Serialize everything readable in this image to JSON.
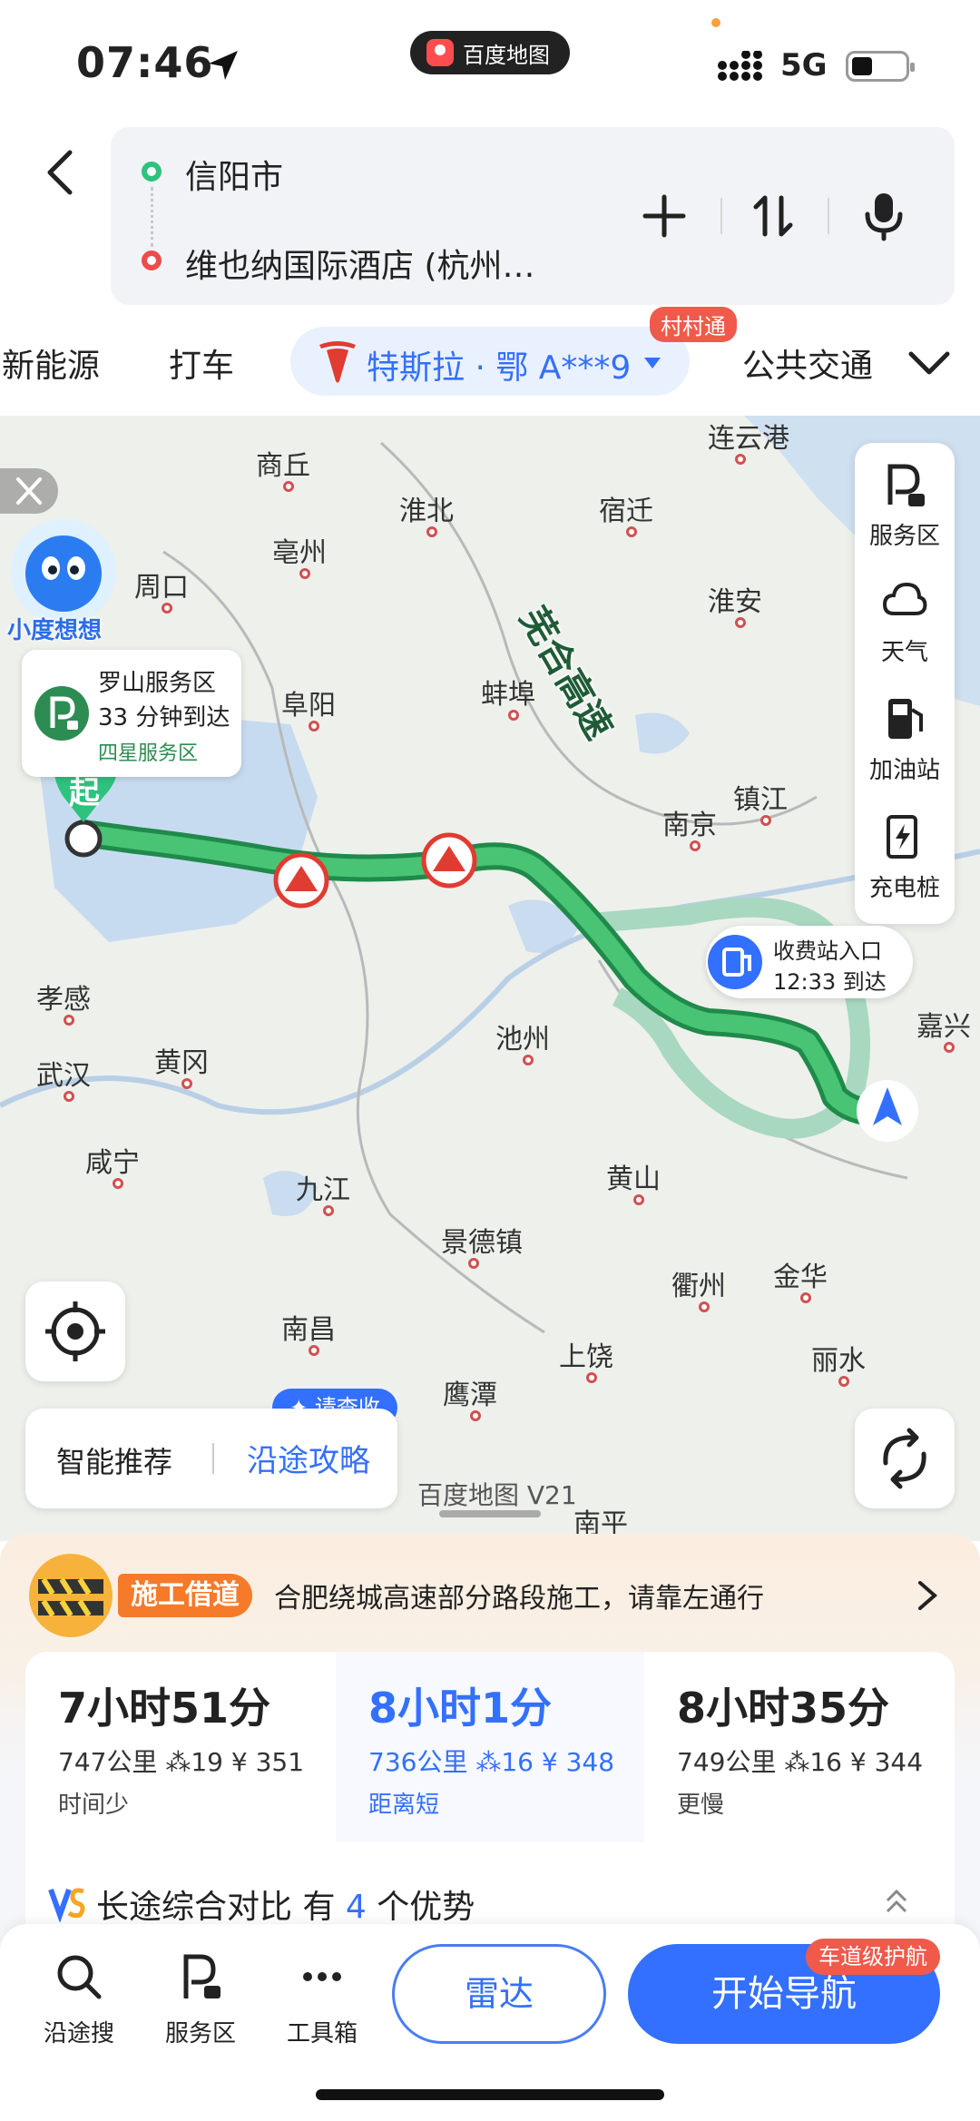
{
  "status_bar": {
    "time": "07:46",
    "app_name": "百度地图",
    "network": "5G"
  },
  "route": {
    "origin": "信阳市",
    "destination": "维也纳国际酒店 (杭州…"
  },
  "modes": {
    "new_energy": "新能源",
    "taxi": "打车",
    "car": "特斯拉 · 鄂 A***9",
    "car_badge": "村村通",
    "transit": "公共交通"
  },
  "map": {
    "cities": [
      "连云港",
      "商丘",
      "淮北",
      "宿迁",
      "亳州",
      "周口",
      "淮安",
      "阜阳",
      "蚌埠",
      "镇江",
      "南京",
      "孝感",
      "池州",
      "嘉兴",
      "武汉",
      "黄冈",
      "咸宁",
      "九江",
      "黄山",
      "景德镇",
      "衢州",
      "金华",
      "南昌",
      "上饶",
      "丽水",
      "鹰潭",
      "南平"
    ],
    "assistant": "小度想想",
    "service_area": {
      "name": "罗山服务区",
      "eta": "33 分钟到达",
      "level": "四星服务区"
    },
    "start_label": "起",
    "highway_label": "芜合高速",
    "toll": {
      "name": "收费站入口",
      "eta": "12:33 到达"
    },
    "side_tools": [
      "服务区",
      "天气",
      "加油站",
      "充电桩"
    ],
    "smart_recommend": "智能推荐",
    "along_guide": "沿途攻略",
    "check_badge": "✦ 请查收",
    "brand": "百度地图 V21"
  },
  "notice": {
    "tag": "施工借道",
    "message": "合肥绕城高速部分路段施工，请靠左通行"
  },
  "route_options": [
    {
      "duration": "7小时51分",
      "distance": "747公里",
      "lights": "19",
      "cost": "¥ 351",
      "tag": "时间少"
    },
    {
      "duration": "8小时1分",
      "distance": "736公里",
      "lights": "16",
      "cost": "¥ 348",
      "tag": "距离短"
    },
    {
      "duration": "8小时35分",
      "distance": "749公里",
      "lights": "16",
      "cost": "¥ 344",
      "tag": "更慢"
    }
  ],
  "compare": {
    "prefix": "长途综合对比 有 ",
    "count": "4",
    "suffix": " 个优势"
  },
  "bottom_nav": {
    "search": "沿途搜",
    "service": "服务区",
    "tools": "工具箱",
    "radar": "雷达",
    "start": "开始导航",
    "lane_badge": "车道级护航"
  },
  "colors": {
    "accent": "#3370ff",
    "route_green": "#34a853",
    "warn_orange": "#f57a2a"
  }
}
